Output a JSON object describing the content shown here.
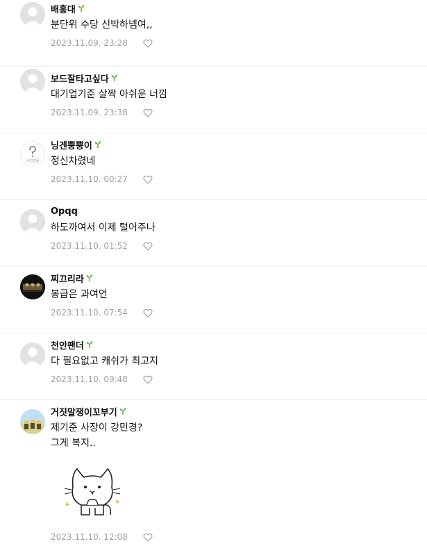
{
  "comments": [
    {
      "nick": "배홍대",
      "text": "분단위 수당 신박하넴여,,",
      "date": "2023.11.09. 23:28",
      "avatar": "default"
    },
    {
      "nick": "보드잘타고싶다",
      "text": "대기업기준 살짝 아쉬운 너낌",
      "date": "2023.11.09. 23:38",
      "avatar": "default"
    },
    {
      "nick": "닝겐뿡뿡이",
      "text": "정신차렸네",
      "date": "2023.11.10. 00:27",
      "avatar": "question"
    },
    {
      "nick": "Opqq",
      "text": "하도까여서 이제 털어주나",
      "date": "2023.11.10. 01:52",
      "avatar": "default"
    },
    {
      "nick": "찌끄리라",
      "text": "봉급은 과여언",
      "date": "2023.11.10. 07:54",
      "avatar": "dark"
    },
    {
      "nick": "천안팬더",
      "text": "다 필요없고 캐쉬가 최고지",
      "date": "2023.11.10. 09:48",
      "avatar": "default"
    },
    {
      "nick": "거짓말쟁이꼬부기",
      "text": "제기준 사장이 강민경?\n그게 복지..",
      "date": "2023.11.10. 12:08",
      "avatar": "figures"
    }
  ],
  "avatar_question_label": "사진없음",
  "colors": {
    "sprout": "#5fb543",
    "date": "#a0a0a0",
    "divider": "#eeeeee"
  },
  "icons": {
    "like": "heart-outline-icon",
    "badge": "sprout-icon"
  }
}
